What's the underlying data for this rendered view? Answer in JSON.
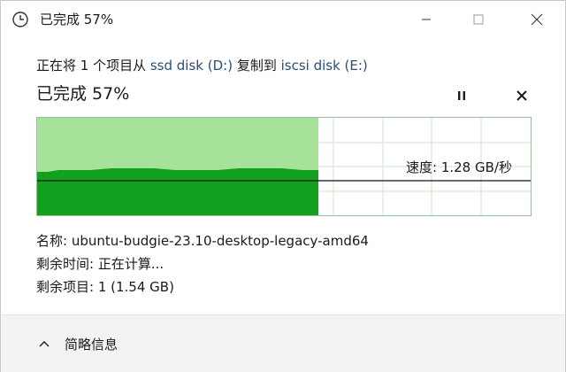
{
  "window": {
    "title": "已完成 57%",
    "icon": "clock-icon"
  },
  "copy_info": {
    "prefix": "正在将 1 个项目从 ",
    "source": "ssd disk (D:)",
    "middle": " 复制到 ",
    "destination": "iscsi disk (E:)"
  },
  "progress": {
    "title": "已完成 57%",
    "percent": 57,
    "speed_label": "速度: 1.28 GB/秒"
  },
  "details": {
    "name_label": "名称: ",
    "name_value": "ubuntu-budgie-23.10-desktop-legacy-amd64",
    "time_label": "剩余时间: ",
    "time_value": "正在计算...",
    "items_label": "剩余项目: ",
    "items_value": "1 (1.54 GB)"
  },
  "footer": {
    "toggle_label": "简略信息"
  },
  "colors": {
    "fill_light": "#a6e29a",
    "fill_dark": "#13a01f",
    "grid": "#cfe5cf",
    "link": "#2a4d7a"
  }
}
